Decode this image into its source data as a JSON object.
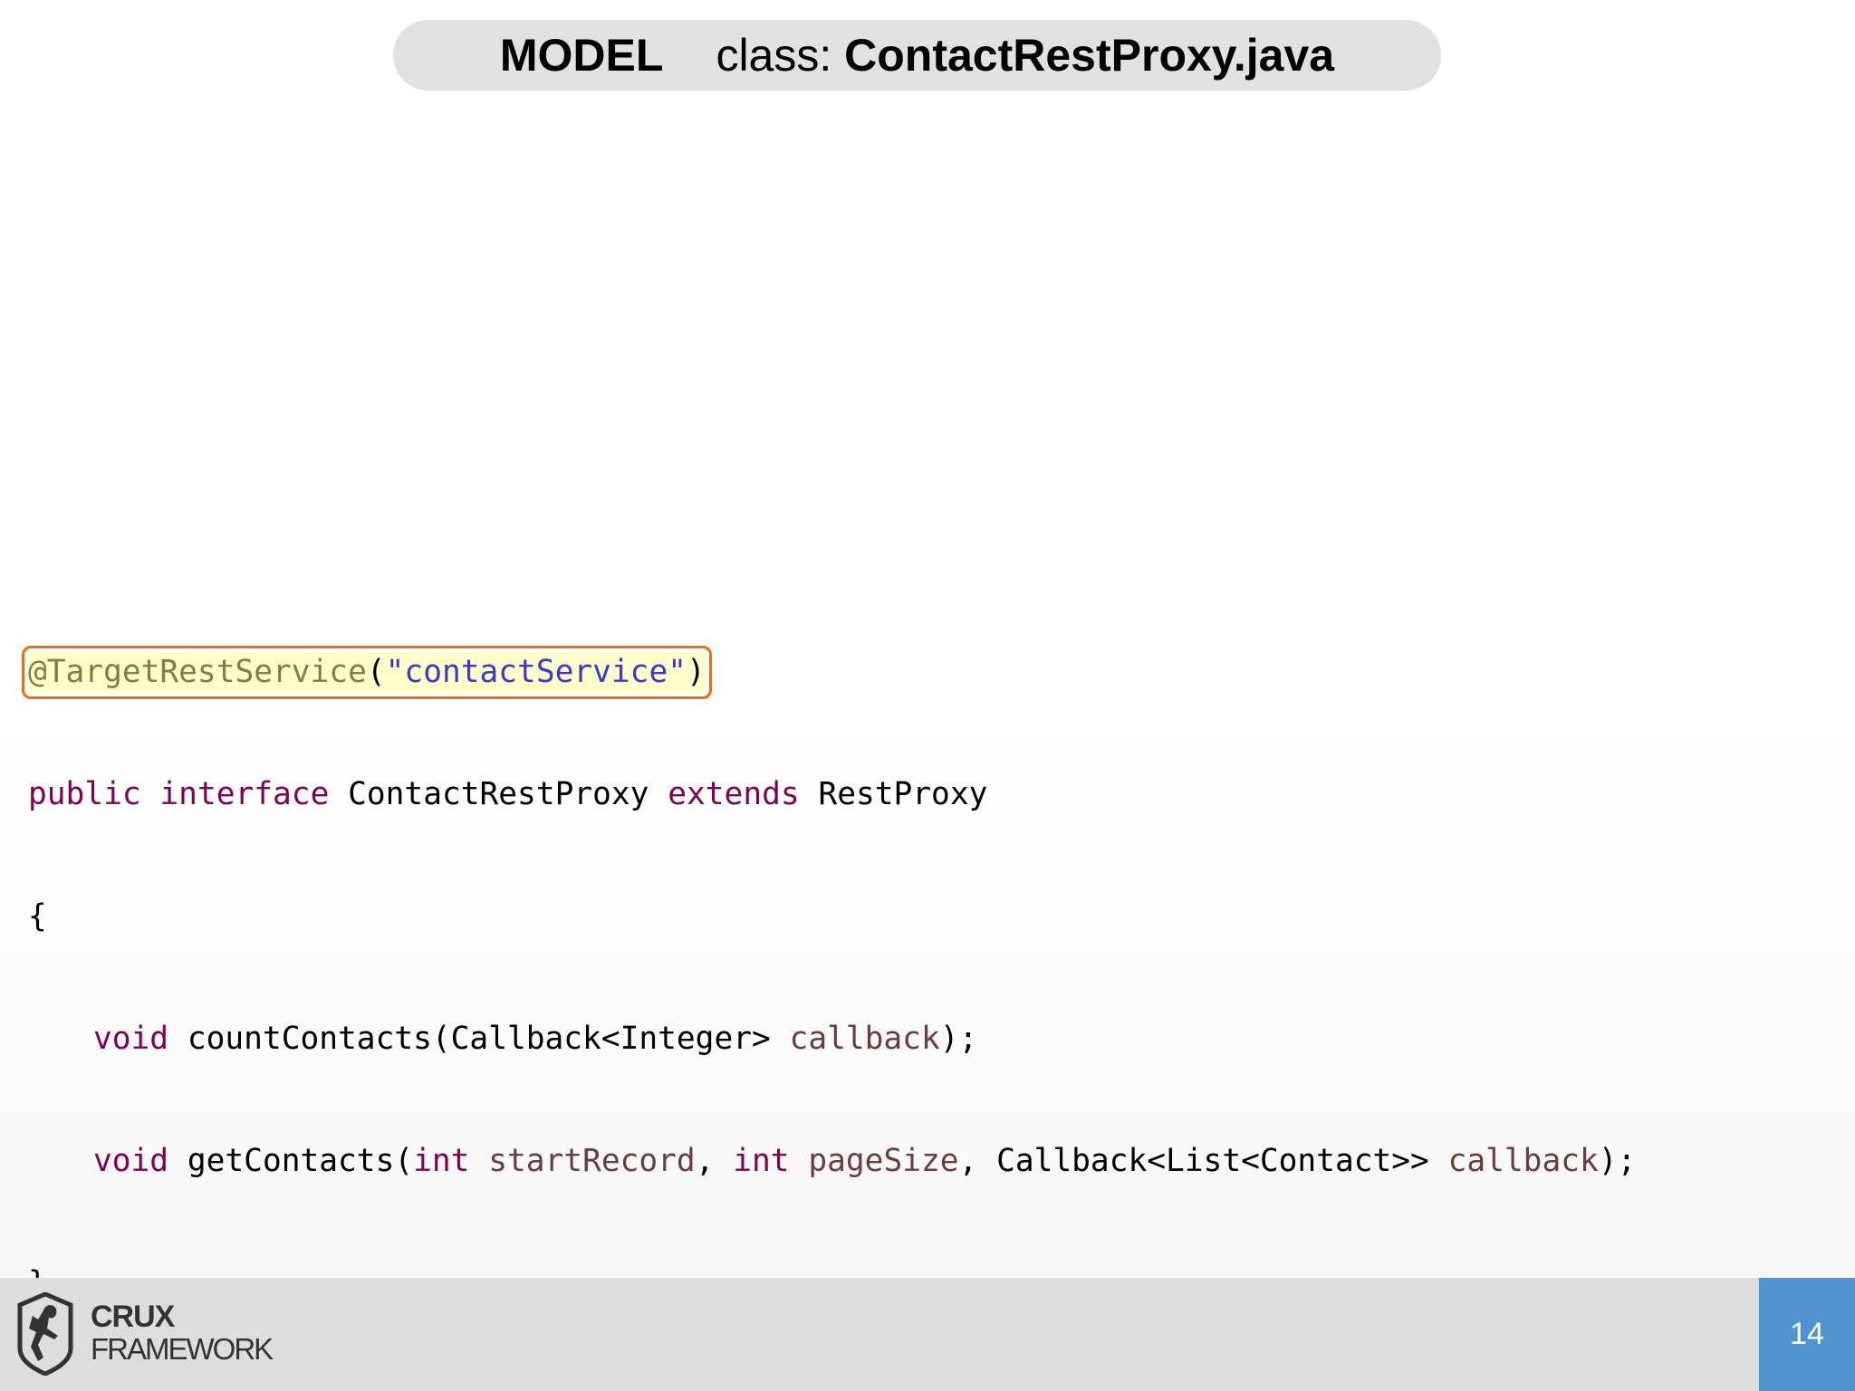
{
  "title": {
    "section": "MODEL",
    "class_label": "class:",
    "class_name": "ContactRestProxy.java"
  },
  "code": {
    "line1": {
      "annotation": "@TargetRestService",
      "open_paren": "(",
      "string": "\"contactService\"",
      "close_paren": ")"
    },
    "line2": {
      "kw_public": "public",
      "kw_interface": "interface",
      "name": "ContactRestProxy",
      "kw_extends": "extends",
      "parent": "RestProxy"
    },
    "line3": {
      "brace": "{"
    },
    "line4": {
      "kw_void": "void",
      "method": "countContacts(Callback<Integer>",
      "param": "callback",
      "end": ");"
    },
    "line5": {
      "kw_void": "void",
      "method": "getContacts(",
      "kw_int1": "int",
      "param1": "startRecord",
      "comma1": ",",
      "kw_int2": "int",
      "param2": "pageSize",
      "type3": ", Callback<List<Contact>>",
      "param3": "callback",
      "end": ");"
    },
    "line6": {
      "brace": "}"
    }
  },
  "footer": {
    "brand_top": "CRUX",
    "brand_bottom": "FRAMEWORK",
    "page_number": "14",
    "accent_color": "#4f94ce"
  },
  "colors": {
    "keyword": "#7f0055",
    "annotation": "#808040",
    "string": "#3a3ac9",
    "parameter": "#6a3e3e",
    "highlight_border": "#ec6f0c",
    "highlight_fill": "#ffffcc"
  }
}
